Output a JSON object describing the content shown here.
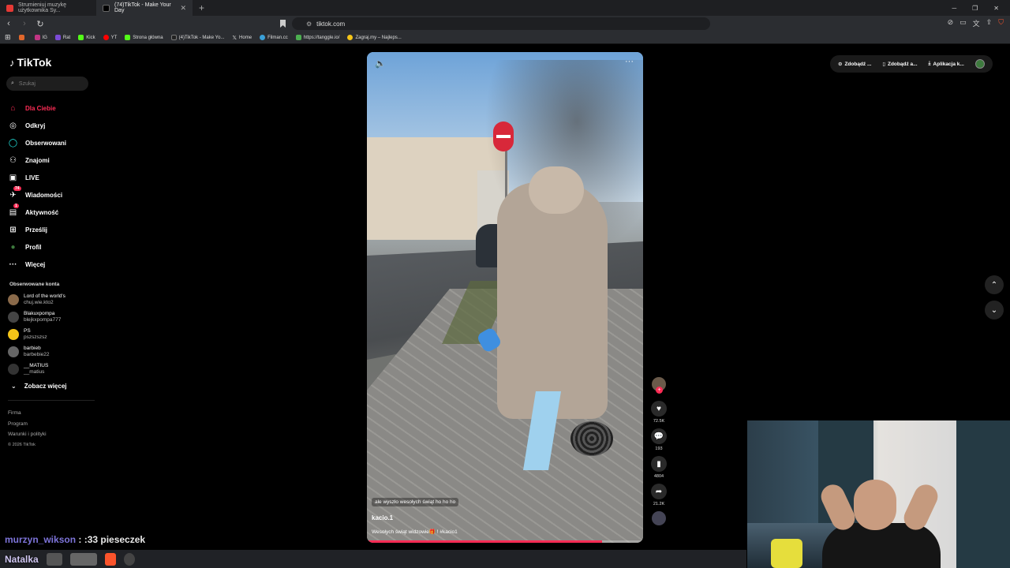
{
  "browser": {
    "tabs": [
      {
        "title": "Strumieniuj muzykę użytkownika Sy...",
        "active": false,
        "color": "#e53935"
      },
      {
        "title": "(74)TikTok - Make Your Day",
        "active": true,
        "color": "#111111"
      }
    ],
    "new_tab": "+",
    "url": "tiktok.com",
    "bookmarks": [
      {
        "label": "",
        "color": "#e0672b"
      },
      {
        "label": "IG",
        "color": "#c13584"
      },
      {
        "label": "Rat",
        "color": "#7b4bd6"
      },
      {
        "label": "Kick",
        "color": "#53fc18"
      },
      {
        "label": "YT",
        "color": "#ff0000"
      },
      {
        "label": "Strona główna",
        "color": "#53fc18"
      },
      {
        "label": "(4)TikTok - Make Yo...",
        "color": "#222222"
      },
      {
        "label": "Home",
        "color": "#444444"
      },
      {
        "label": "Filman.cc",
        "color": "#3aa0d8"
      },
      {
        "label": "https://tanggle.io/",
        "color": "#4caf50"
      },
      {
        "label": "Zagraj.my – Najleps...",
        "color": "#f5c518"
      }
    ]
  },
  "sidebar": {
    "logo": "TikTok",
    "search_placeholder": "Szukaj",
    "nav": [
      {
        "label": "Dla Ciebie",
        "icon": "home-icon",
        "glyph": "⌂",
        "active": true
      },
      {
        "label": "Odkryj",
        "icon": "compass-icon",
        "glyph": "◎"
      },
      {
        "label": "Obserwowani",
        "icon": "following-icon",
        "glyph": "◯"
      },
      {
        "label": "Znajomi",
        "icon": "friends-icon",
        "glyph": "👥"
      },
      {
        "label": "LIVE",
        "icon": "live-icon",
        "glyph": "▣"
      },
      {
        "label": "Wiadomości",
        "icon": "messages-icon",
        "glyph": "✈",
        "badge": "74"
      },
      {
        "label": "Aktywność",
        "icon": "activity-icon",
        "glyph": "▤",
        "badge": "1"
      },
      {
        "label": "Prześlij",
        "icon": "upload-icon",
        "glyph": "⊞"
      },
      {
        "label": "Profil",
        "icon": "profile-icon",
        "glyph": "●"
      },
      {
        "label": "Więcej",
        "icon": "more-icon",
        "glyph": "···"
      }
    ],
    "followed_title": "Obserwowane konta",
    "followed": [
      {
        "name": "Lord of the world's",
        "user": "chuj.wie.kto2"
      },
      {
        "name": "Blakuxpompa",
        "user": "blejkxpompa777"
      },
      {
        "name": "PS",
        "user": "pszszszsz"
      },
      {
        "name": "barbieb",
        "user": "barbebie22"
      },
      {
        "name": "__MATIUS",
        "user": "__matius"
      }
    ],
    "see_more": "Zobacz więcej",
    "footer": [
      "Firma",
      "Program",
      "Warunki i polityki"
    ],
    "copyright": "© 2026 TikTok"
  },
  "video": {
    "overlay_caption": "ale wyszło wesołych świąt ho ho ho",
    "author": "kacio.1",
    "description": "Wesołych świąt widzowie🎁 ! #kacio1",
    "progress_percent": 85
  },
  "actions": {
    "likes": "72.5K",
    "comments": "193",
    "saves": "4804",
    "shares": "21.2K"
  },
  "topright": {
    "items": [
      "Zdobądź ...",
      "Zdobądź a...",
      "Aplikacja k..."
    ]
  },
  "stream": {
    "chat_user": "murzyn_wikson",
    "chat_message": " : :33 pieseczek",
    "taskbar_name": "Natalka"
  }
}
